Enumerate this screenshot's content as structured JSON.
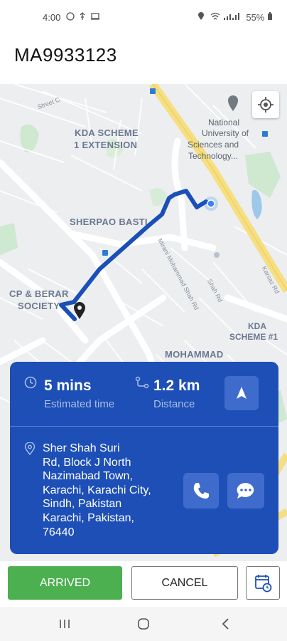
{
  "status_bar": {
    "time": "4:00",
    "battery": "55%",
    "left_icons": [
      "whatsapp-icon",
      "usb-icon",
      "laptop-icon"
    ],
    "right_icons": [
      "location-icon",
      "wifi-icon",
      "signal-icon",
      "battery-icon"
    ]
  },
  "header": {
    "title": "MA9933123"
  },
  "map": {
    "labels": {
      "kda_scheme_1_ext_line1": "KDA SCHEME",
      "kda_scheme_1_ext_line2": "1 EXTENSION",
      "sherpao_basti": "SHERPAO BASTI",
      "cp_berar_line1": "CP & BERAR",
      "cp_berar_line2": "SOCIETY",
      "kda_scheme_1_line1": "KDA",
      "kda_scheme_1_line2": "SCHEME #1",
      "mohammad": "MOHAMMAD",
      "nust_line1": "National",
      "nust_line2": "University of",
      "nust_line3": "Sciences and",
      "nust_line4": "Technology...",
      "street_c": "Street C",
      "mirani_road": "Mirani Mohammad Shah Rd",
      "karsaz_road": "Karsaz Rd",
      "road_small": "Shah Rd"
    },
    "accent": "#1d4fb6",
    "route_color": "#1a4fb8"
  },
  "trip_card": {
    "time_value": "5 mins",
    "time_label": "Estimated time",
    "distance_value": "1.2 km",
    "distance_label": "Distance",
    "address_lines": [
      "Sher Shah Suri",
      "Rd, Block J North",
      "Nazimabad Town,",
      "Karachi, Karachi City,",
      "Sindh, Pakistan",
      "Karachi, Pakistan,",
      "76440"
    ],
    "background": "#1d4fb6"
  },
  "actions": {
    "arrived_label": "ARRIVED",
    "cancel_label": "CANCEL",
    "arrived_color": "#4caf50"
  }
}
